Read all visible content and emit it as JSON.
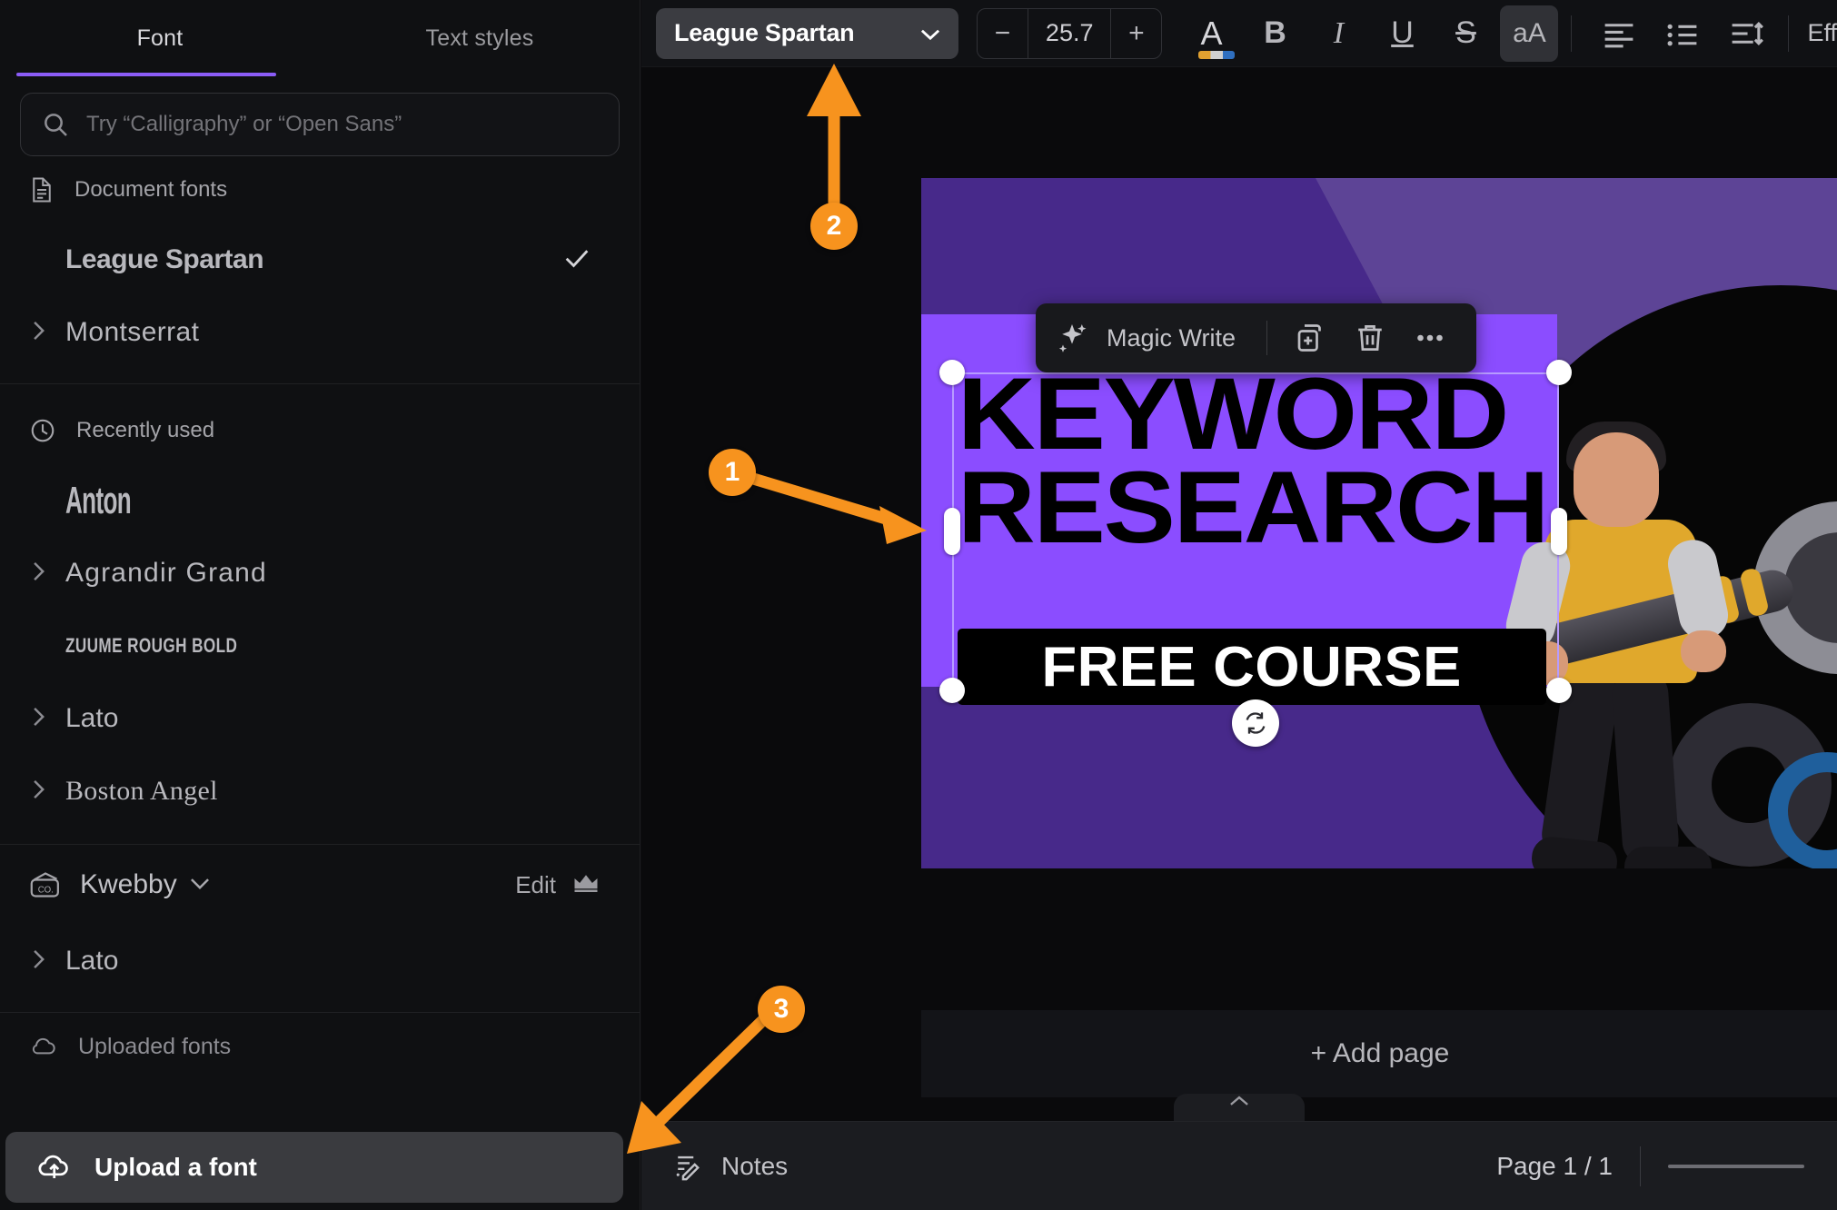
{
  "sidebar": {
    "tabs": [
      {
        "label": "Font",
        "active": true
      },
      {
        "label": "Text styles",
        "active": false
      }
    ],
    "search": {
      "placeholder": "Try “Calligraphy” or “Open Sans”",
      "value": ""
    },
    "groups": [
      {
        "header": "Document fonts",
        "header_icon": "document-icon",
        "items": [
          {
            "label": "League Spartan",
            "chevron": false,
            "checked": true,
            "style": "fn-league"
          },
          {
            "label": "Montserrat",
            "chevron": true,
            "checked": false,
            "style": "fn-mont"
          }
        ]
      },
      {
        "header": "Recently used",
        "header_icon": "clock-icon",
        "items": [
          {
            "label": "Anton",
            "chevron": false,
            "checked": false,
            "style": "fn-anton"
          },
          {
            "label": "Agrandir Grand",
            "chevron": true,
            "checked": false,
            "style": "fn-agrand"
          },
          {
            "label": "ZUUME ROUGH BOLD",
            "chevron": false,
            "checked": false,
            "style": "fn-zuume"
          },
          {
            "label": "Lato",
            "chevron": true,
            "checked": false,
            "style": "fn-lato"
          },
          {
            "label": "Boston Angel",
            "chevron": true,
            "checked": false,
            "style": "fn-boston"
          }
        ]
      }
    ],
    "brand": {
      "name": "Kwebby",
      "icon": "brand-kit-icon",
      "caret": "chevron-down-icon",
      "edit_label": "Edit",
      "crown_icon": "crown-icon",
      "items": [
        {
          "label": "Lato",
          "chevron": true,
          "checked": false,
          "style": "fn-lato"
        }
      ]
    },
    "uploaded_section_label": "Uploaded fonts",
    "upload_button": {
      "label": "Upload a font",
      "icon": "cloud-upload-icon"
    }
  },
  "toolbar": {
    "font_name": "League Spartan",
    "font_caret": "chevron-down-icon",
    "size": {
      "decrease": "−",
      "value": "25.7",
      "increase": "+"
    },
    "buttons": [
      {
        "name": "font-color",
        "glyph": "A",
        "active": false
      },
      {
        "name": "bold",
        "glyph": "B",
        "active": false
      },
      {
        "name": "italic",
        "glyph": "I",
        "active": false
      },
      {
        "name": "underline",
        "glyph": "U",
        "active": false
      },
      {
        "name": "strikethrough",
        "glyph": "S",
        "active": false
      },
      {
        "name": "letter-case",
        "glyph": "aA",
        "active": true
      }
    ],
    "align_icon": "text-align-left-icon",
    "list_icon": "bulleted-list-icon",
    "spacing_icon": "line-spacing-icon",
    "effects_label": "Eff"
  },
  "context_toolbar": {
    "magic_write": {
      "label": "Magic Write",
      "icon": "sparkle-icon"
    },
    "duplicate_icon": "duplicate-icon",
    "delete_icon": "trash-icon",
    "more_icon": "more-horizontal-icon"
  },
  "canvas": {
    "headline": "KEYWORD RESEARCH",
    "subline": "FREE COURSE",
    "rotate_icon": "rotate-icon",
    "add_page_label": "+ Add page",
    "collapse_icon": "chevron-up-icon",
    "page_background": "#47298a",
    "accent_purple": "#8b4dff"
  },
  "bottom_bar": {
    "notes_label": "Notes",
    "notes_icon": "notes-icon",
    "page_indicator": "Page 1 / 1"
  },
  "annotations": [
    {
      "number": "1"
    },
    {
      "number": "2"
    },
    {
      "number": "3"
    }
  ],
  "colors": {
    "annotation": "#f7931e",
    "tab_underline": "#8b5cf6"
  }
}
